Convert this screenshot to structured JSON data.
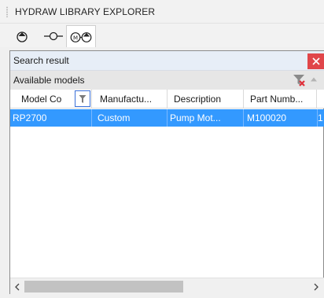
{
  "panel": {
    "title": "HYDRAW LIBRARY EXPLORER"
  },
  "tabs": [
    {
      "icon": "pump-icon",
      "active": false
    },
    {
      "icon": "valve-icon",
      "active": false
    },
    {
      "icon": "motor-pump-icon",
      "active": true
    }
  ],
  "search": {
    "label": "Search result"
  },
  "models": {
    "label": "Available models"
  },
  "grid": {
    "columns": [
      "Model Co",
      "Manufactu...",
      "Description",
      "Part Numb..."
    ],
    "rows": [
      {
        "cells": [
          "RP2700",
          "Custom",
          "Pump Mot...",
          "M100020",
          "1"
        ],
        "selected": true
      }
    ]
  },
  "colors": {
    "selection": "#3399ff",
    "close": "#e0464a",
    "search_bar": "#e7eef7",
    "filter_border": "#3a6fd8"
  },
  "scroll": {
    "horizontal_position_pct": 0
  }
}
